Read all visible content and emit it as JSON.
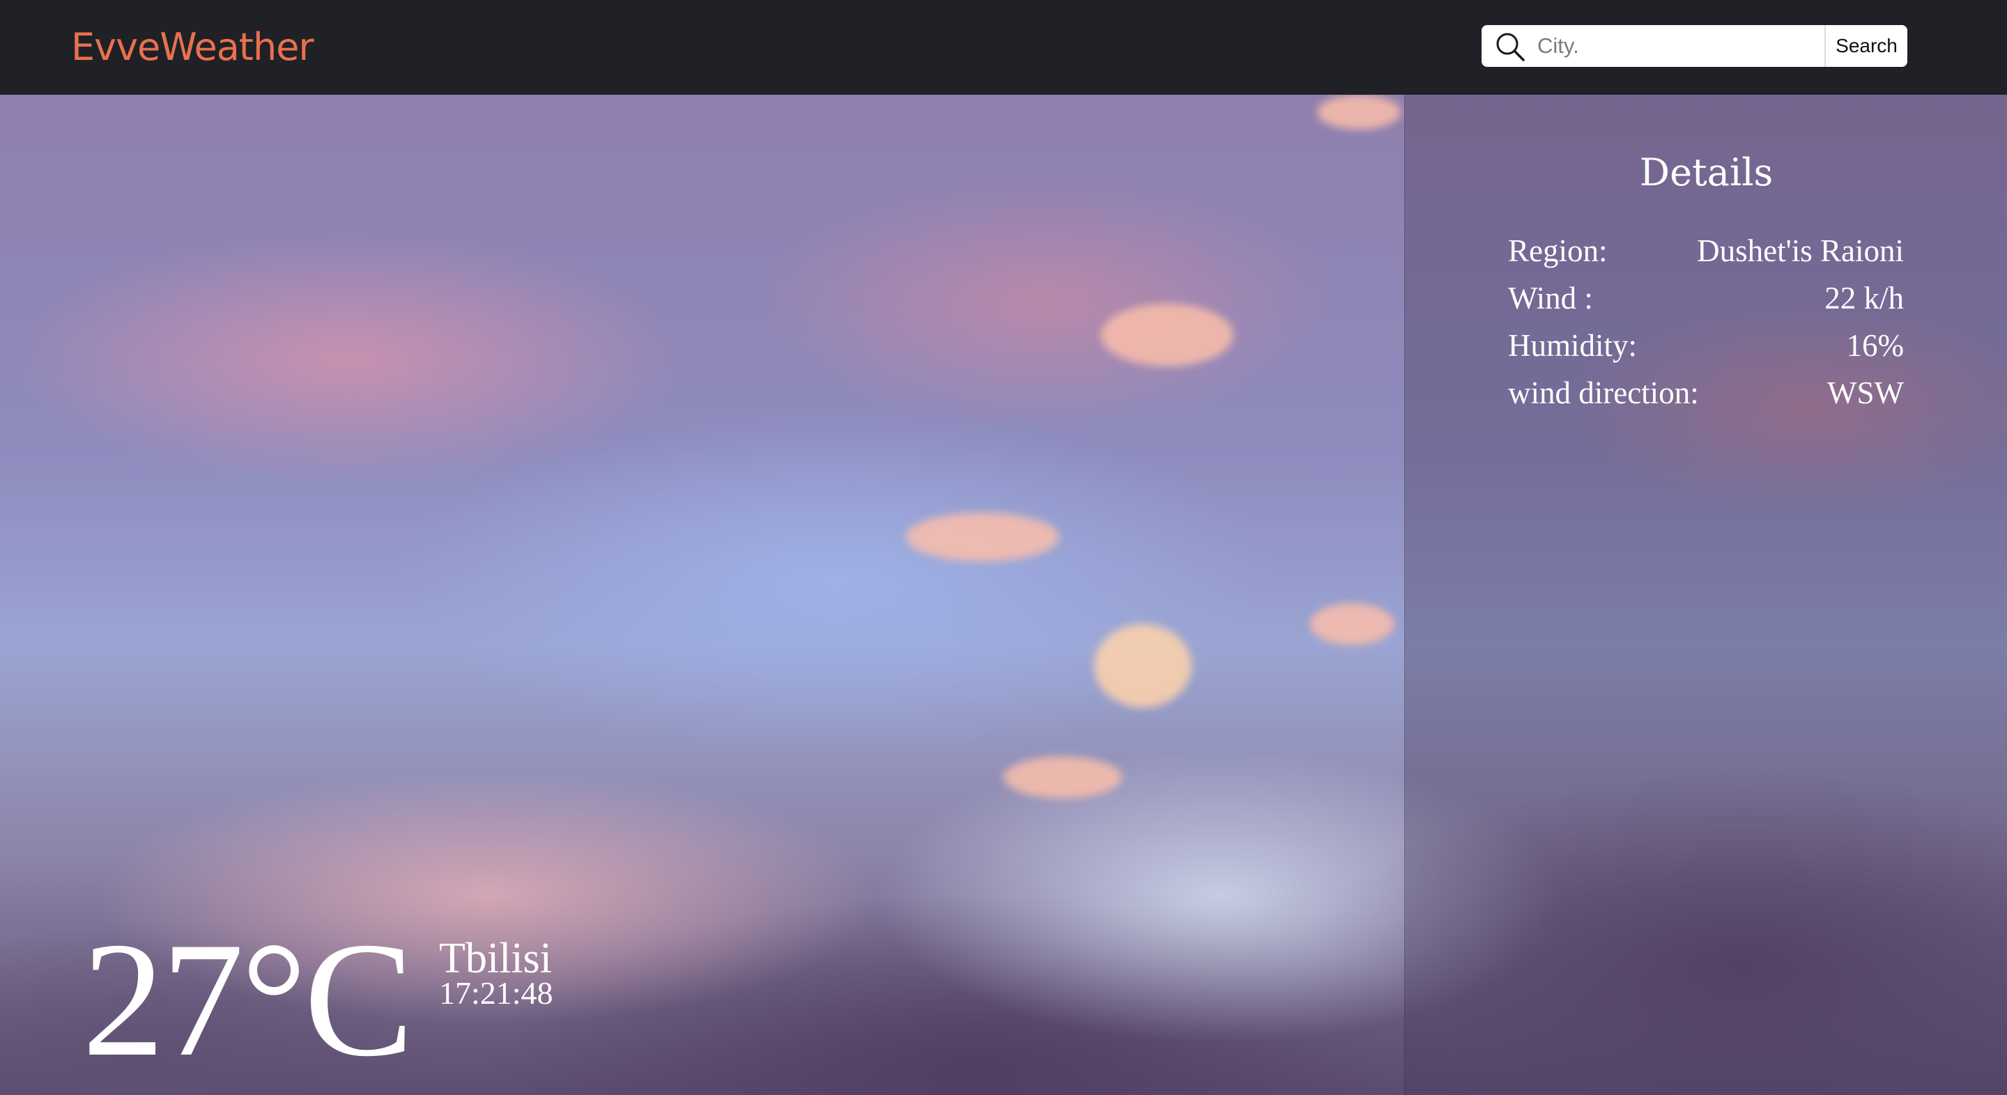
{
  "header": {
    "logo": "EvveWeather",
    "search": {
      "placeholder": "City.",
      "value": "",
      "button_label": "Search",
      "icon": "search-icon"
    }
  },
  "details": {
    "title": "Details",
    "rows": [
      {
        "label": "Region:",
        "value": "Dushet'is Raioni"
      },
      {
        "label": "Wind :",
        "value": "22 k/h"
      },
      {
        "label": "Humidity:",
        "value": "16%"
      },
      {
        "label": "wind direction:",
        "value": "WSW"
      }
    ]
  },
  "current": {
    "temperature": "27°C",
    "city": "Tbilisi",
    "time": "17:21:48"
  },
  "colors": {
    "navbar_bg": "#1f2126",
    "logo": "#e9714d",
    "text": "#ffffff"
  }
}
